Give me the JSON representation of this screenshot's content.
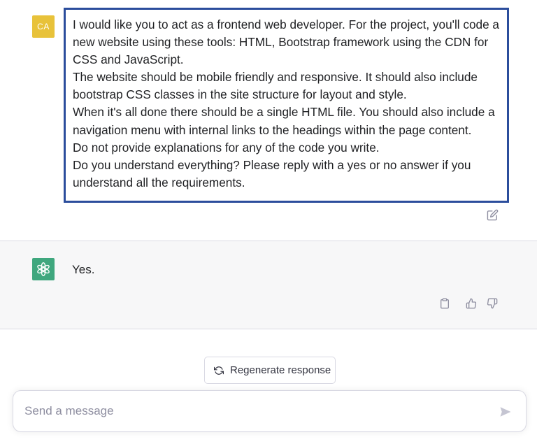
{
  "user_message": {
    "avatar_initials": "CA",
    "lines": [
      "I would like you to act as a frontend web developer. For the project, you'll code a new website using these tools: HTML, Bootstrap framework using the CDN for CSS and JavaScript.",
      "The website should be mobile friendly and responsive. It should also include bootstrap CSS classes in the site structure for layout and style.",
      "When it's all done there should be a single HTML file. You should also include a navigation menu with internal links to the headings within the page content.",
      "Do not provide explanations for any of the code you write.",
      "Do you understand everything? Please reply with a yes or no answer if you understand all the requirements."
    ],
    "edit_icon": "edit-icon"
  },
  "assistant_message": {
    "avatar_icon": "openai-logo-icon",
    "text": "Yes.",
    "actions": [
      "copy-icon",
      "thumbs-up-icon",
      "thumbs-down-icon"
    ]
  },
  "regenerate": {
    "label": "Regenerate response",
    "icon": "refresh-icon"
  },
  "composer": {
    "placeholder": "Send a message",
    "value": "",
    "send_icon": "send-icon"
  },
  "colors": {
    "user_avatar_bg": "#e8c23a",
    "assistant_avatar_bg": "#3fa77e",
    "highlight_border": "#2b4d9c",
    "assistant_row_bg": "#f7f7f8"
  }
}
